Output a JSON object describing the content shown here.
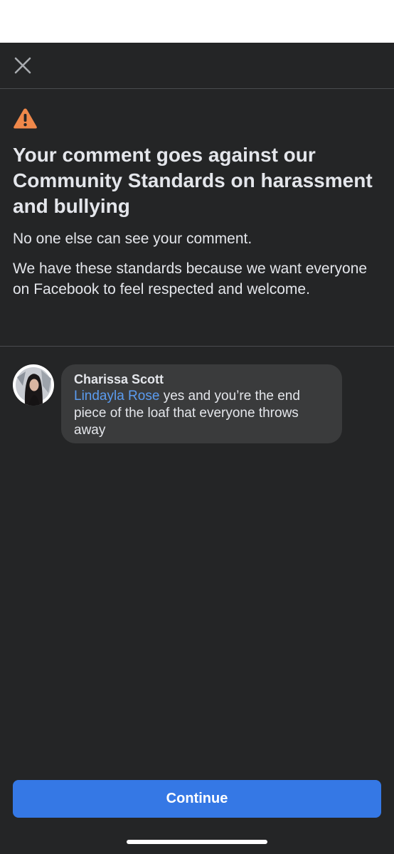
{
  "header": {
    "close_icon": "close-icon"
  },
  "warning": {
    "icon": "warning-triangle-icon",
    "icon_color": "#f0884a",
    "title": "Your comment goes against our Community Standards on harassment and bullying",
    "visibility_note": "No one else can see your comment.",
    "explanation": "We have these standards because we want everyone on Facebook to feel respected and welcome."
  },
  "comment": {
    "author": "Charissa Scott",
    "mention": "Lindayla Rose",
    "text": " yes and you’re the end piece of the loaf that everyone throws away",
    "mention_color": "#5b9cf0"
  },
  "actions": {
    "continue_label": "Continue",
    "button_color": "#3578e5"
  },
  "theme": {
    "background": "#242526",
    "bubble": "#3a3b3c"
  }
}
